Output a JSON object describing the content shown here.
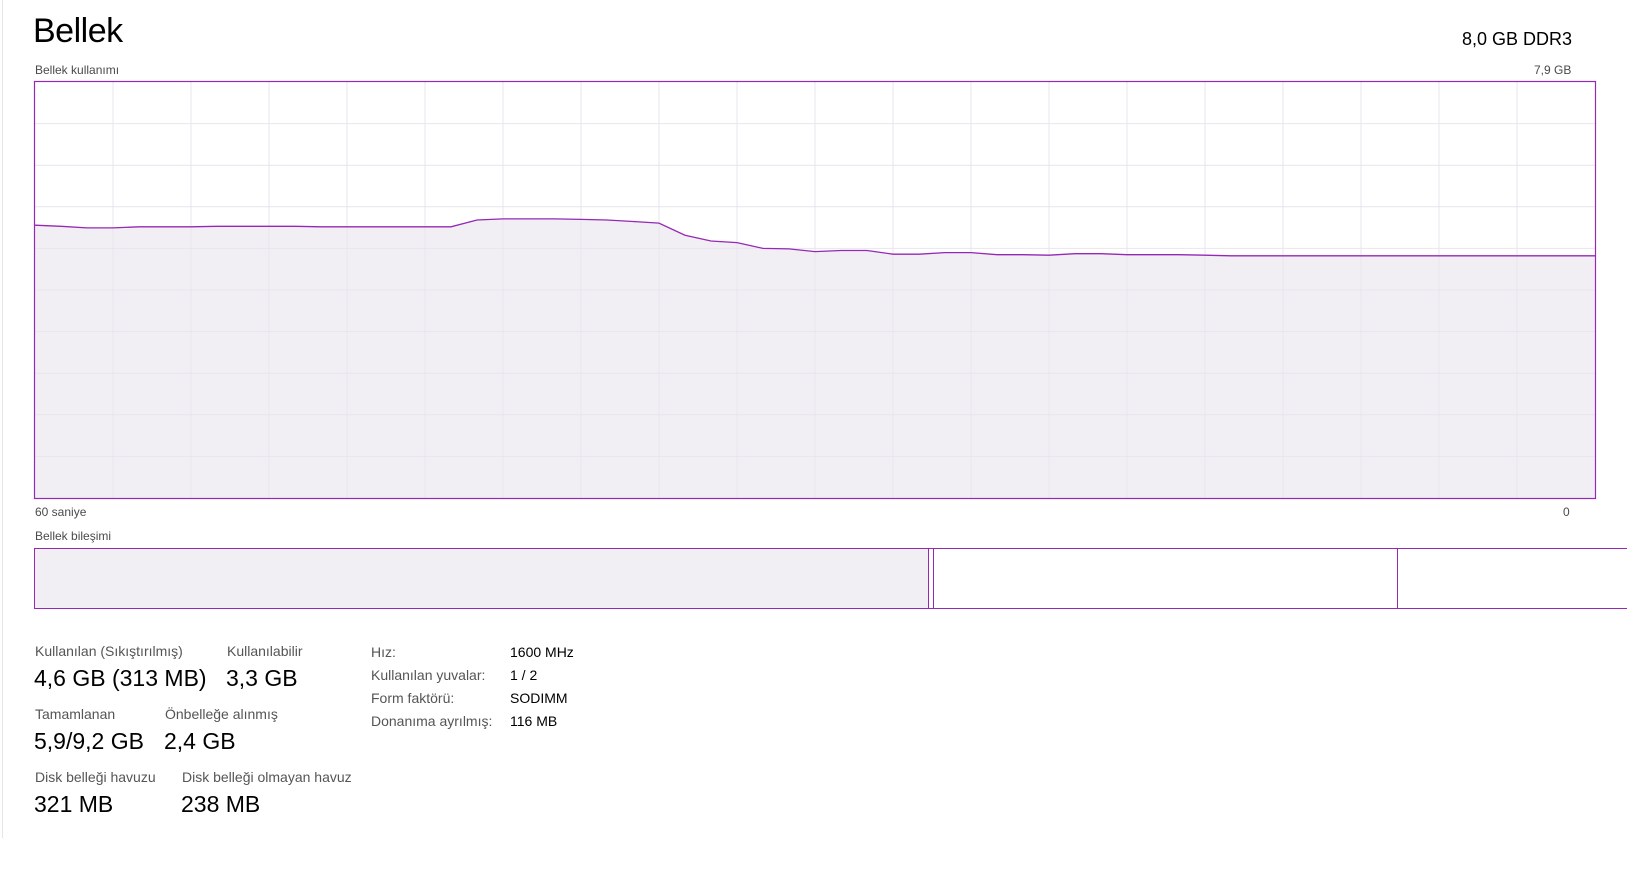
{
  "header": {
    "title": "Bellek",
    "spec": "8,0 GB DDR3"
  },
  "usage_graph": {
    "label": "Bellek kullanımı",
    "max_label": "7,9 GB",
    "time_left_label": "60 saniye",
    "time_right_label": "0"
  },
  "chart_data": {
    "type": "area",
    "title": "Bellek kullanımı",
    "ylim": [
      0,
      7.9
    ],
    "y_unit": "GB",
    "x_unit": "saniye",
    "xlim": [
      60,
      0
    ],
    "grid": true,
    "x": [
      60,
      59,
      58,
      57,
      56,
      55,
      54,
      53,
      52,
      51,
      50,
      49,
      48,
      47,
      46,
      45,
      44,
      43,
      42,
      41,
      40,
      39,
      38,
      37,
      36,
      35,
      34,
      33,
      32,
      31,
      30,
      29,
      28,
      27,
      26,
      25,
      24,
      23,
      22,
      21,
      20,
      19,
      18,
      17,
      16,
      15,
      14,
      13,
      12,
      11,
      10,
      9,
      8,
      7,
      6,
      5,
      4,
      3,
      2,
      1,
      0
    ],
    "values": [
      5.18,
      5.16,
      5.13,
      5.13,
      5.15,
      5.15,
      5.15,
      5.16,
      5.16,
      5.16,
      5.16,
      5.15,
      5.15,
      5.15,
      5.15,
      5.15,
      5.15,
      5.28,
      5.3,
      5.3,
      5.3,
      5.29,
      5.28,
      5.25,
      5.22,
      4.99,
      4.88,
      4.85,
      4.74,
      4.73,
      4.68,
      4.7,
      4.7,
      4.63,
      4.63,
      4.66,
      4.66,
      4.62,
      4.62,
      4.61,
      4.64,
      4.64,
      4.62,
      4.62,
      4.62,
      4.61,
      4.6,
      4.6,
      4.6,
      4.6,
      4.6,
      4.6,
      4.6,
      4.6,
      4.6,
      4.6,
      4.6,
      4.6,
      4.6,
      4.6,
      4.6
    ]
  },
  "composition": {
    "label": "Bellek bileşimi",
    "segments_fraction": {
      "in_use": 0.559,
      "modified": 0.003,
      "standby": 0.29,
      "free": 0.148
    }
  },
  "stats": {
    "in_use": {
      "label": "Kullanılan (Sıkıştırılmış)",
      "value": "4,6 GB (313 MB)"
    },
    "available": {
      "label": "Kullanılabilir",
      "value": "3,3 GB"
    },
    "committed": {
      "label": "Tamamlanan",
      "value": "5,9/9,2 GB"
    },
    "cached": {
      "label": "Önbelleğe alınmış",
      "value": "2,4 GB"
    },
    "paged_pool": {
      "label": "Disk belleği havuzu",
      "value": "321 MB"
    },
    "nonpaged_pool": {
      "label": "Disk belleği olmayan havuz",
      "value": "238 MB"
    }
  },
  "hardware": {
    "speed": {
      "label": "Hız:",
      "value": "1600 MHz"
    },
    "slots": {
      "label": "Kullanılan yuvalar:",
      "value": "1 / 2"
    },
    "form_factor": {
      "label": "Form faktörü:",
      "value": "SODIMM"
    },
    "reserved": {
      "label": "Donanıma ayrılmış:",
      "value": "116 MB"
    }
  },
  "colors": {
    "accent": "#9528b4",
    "fill": "#f2eff4",
    "grid": "#e8e4ee"
  }
}
